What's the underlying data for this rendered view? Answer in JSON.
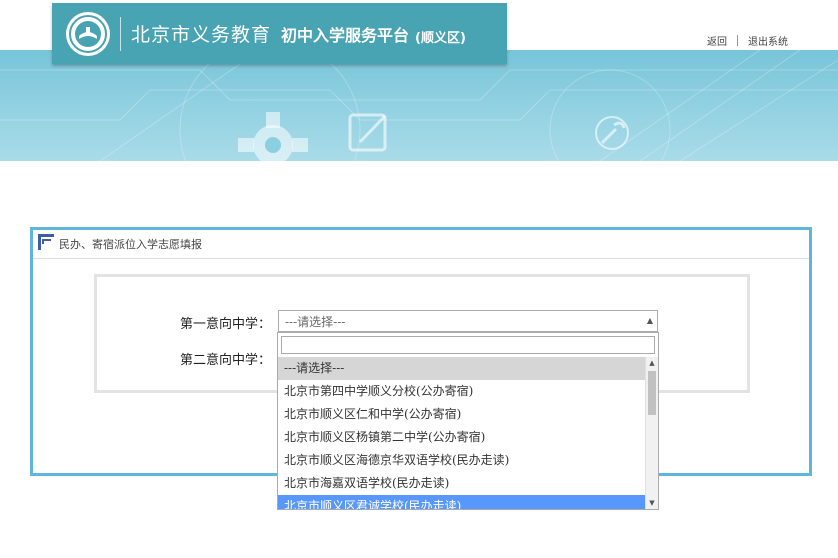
{
  "header": {
    "brand_main": "北京市义务教育",
    "brand_sub": "初中入学服务平台",
    "brand_district": "(顺义区)",
    "links": [
      "返回",
      "退出系统"
    ]
  },
  "form": {
    "title": "民办、寄宿派位入学志愿填报",
    "first_choice_label": "第一意向中学：",
    "second_choice_label": "第二意向中学：",
    "select_placeholder": "---请选择---"
  },
  "dropdown": {
    "options": [
      "---请选择---",
      "北京市第四中学顺义分校(公办寄宿)",
      "北京市顺义区仁和中学(公办寄宿)",
      "北京市顺义区杨镇第二中学(公办寄宿)",
      "北京市顺义区海德京华双语学校(民办走读)",
      "北京市海嘉双语学校(民办走读)",
      "北京市顺义区君诚学校(民办走读)"
    ]
  },
  "colors": {
    "brand": "#48a3b3",
    "card_border": "#5fb6dc",
    "highlight": "#5897fb"
  }
}
